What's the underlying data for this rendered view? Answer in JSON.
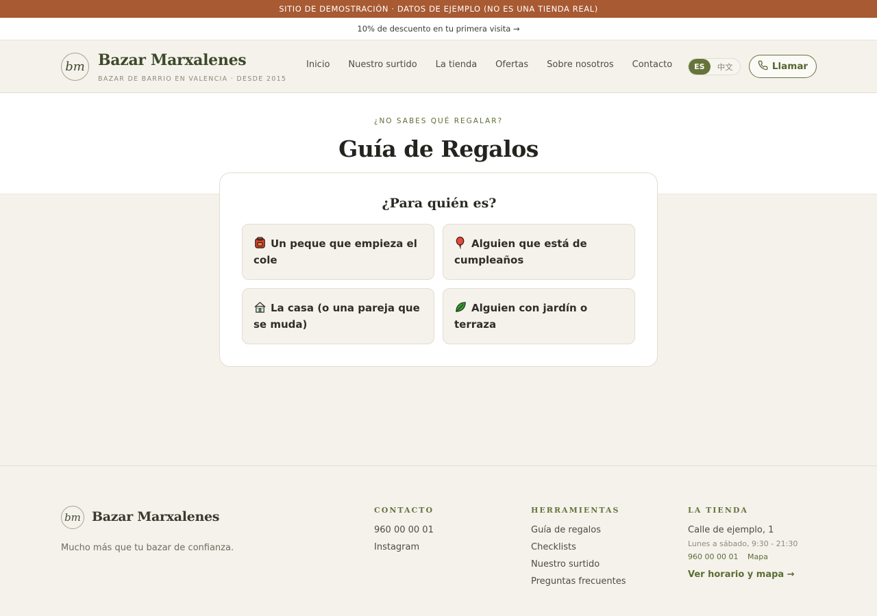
{
  "banner": {
    "demo_text": "SITIO DE DEMOSTRACIÓN · DATOS DE EJEMPLO (NO ES UNA TIENDA REAL)"
  },
  "promo": {
    "text": "10% de descuento en tu primera visita →"
  },
  "header": {
    "logo_mark": "bm",
    "logo_name": "Bazar Marxalenes",
    "logo_tagline": "BAZAR DE BARRIO EN VALENCIA · DESDE 2015",
    "nav": [
      "Inicio",
      "Nuestro surtido",
      "La tienda",
      "Ofertas",
      "Sobre nosotros",
      "Contacto"
    ],
    "lang_active": "ES",
    "lang_other": "中文",
    "call_label": "Llamar",
    "call_icon": "phone-icon"
  },
  "hero": {
    "eyebrow": "¿NO SABES QUÉ REGALAR?",
    "title": "Guía de Regalos"
  },
  "picker": {
    "title": "¿Para quién es?",
    "options": [
      {
        "label": "Un peque que empieza el cole",
        "icon": "backpack-icon"
      },
      {
        "label": "Alguien que está de cumpleaños",
        "icon": "balloon-icon"
      },
      {
        "label": "La casa (o una pareja que se muda)",
        "icon": "house-icon"
      },
      {
        "label": "Alguien con jardín o terraza",
        "icon": "leaf-icon"
      }
    ]
  },
  "footer": {
    "logo_mark": "bm",
    "logo_name": "Bazar Marxalenes",
    "tagline": "Mucho más que tu bazar de confianza.",
    "contact": {
      "heading": "CONTACTO",
      "links": [
        "960 00 00 01",
        "Instagram"
      ]
    },
    "tools": {
      "heading": "HERRAMIENTAS",
      "links": [
        "Guía de regalos",
        "Checklists",
        "Nuestro surtido",
        "Preguntas frecuentes"
      ]
    },
    "store": {
      "heading": "LA TIENDA",
      "address": "Calle de ejemplo, 1",
      "hours": "Lunes a sábado, 9:30 - 21:30",
      "phone": "960 00 00 01",
      "map": "Mapa",
      "more": "Ver horario y mapa →"
    }
  },
  "colors": {
    "accent": "#66743a",
    "banner": "#a85a33",
    "background": "#f5f2ec"
  }
}
